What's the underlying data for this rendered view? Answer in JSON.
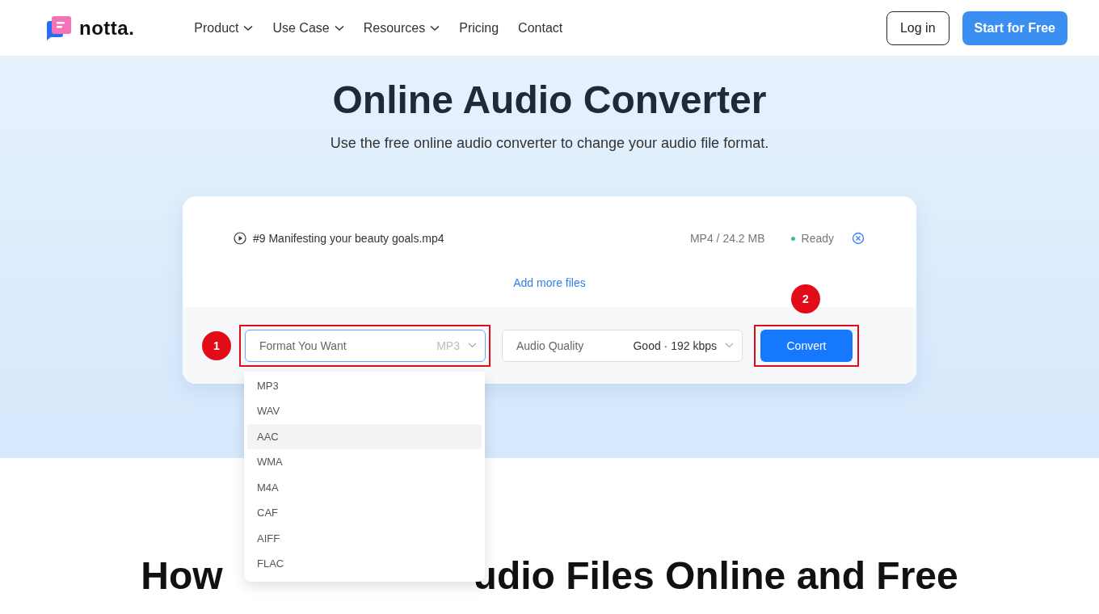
{
  "nav": {
    "logo": "notta.",
    "menu": [
      {
        "label": "Product",
        "dropdown": true
      },
      {
        "label": "Use Case",
        "dropdown": true
      },
      {
        "label": "Resources",
        "dropdown": true
      },
      {
        "label": "Pricing",
        "dropdown": false
      },
      {
        "label": "Contact",
        "dropdown": false
      }
    ],
    "login": "Log in",
    "cta": "Start for Free"
  },
  "hero": {
    "title": "Online Audio Converter",
    "subtitle": "Use the free online audio converter to change your audio file format."
  },
  "file": {
    "name": "#9 Manifesting your beauty goals.mp4",
    "info": "MP4 / 24.2 MB",
    "status": "Ready",
    "color": "#2fc48d"
  },
  "add_more": "Add more files",
  "format": {
    "label": "Format You Want",
    "value": "MP3",
    "expanded": true,
    "badge": "1",
    "options": [
      {
        "label": "MP3",
        "highlighted": false
      },
      {
        "label": "WAV",
        "highlighted": false
      },
      {
        "label": "AAC",
        "highlighted": true
      },
      {
        "label": "WMA",
        "highlighted": false
      },
      {
        "label": "M4A",
        "highlighted": false
      },
      {
        "label": "CAF",
        "highlighted": false
      },
      {
        "label": "AIFF",
        "highlighted": false
      },
      {
        "label": "FLAC",
        "highlighted": false
      }
    ]
  },
  "quality": {
    "label": "Audio Quality",
    "value": "Good · 192 kbps"
  },
  "convert": {
    "label": "Convert",
    "badge": "2"
  },
  "section_heading": {
    "visible_start": "How",
    "visible_end": "udio Files Online and Free"
  }
}
